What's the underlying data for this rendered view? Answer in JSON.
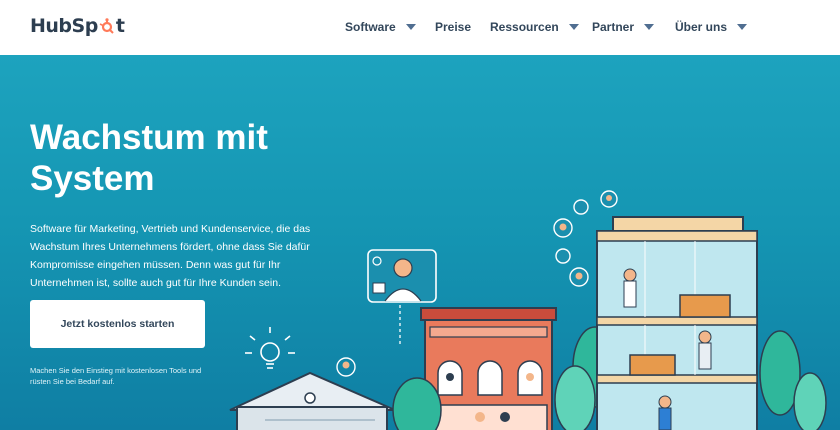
{
  "brand": {
    "logo_text_left": "HubSp",
    "logo_text_right": "t"
  },
  "nav": {
    "items": [
      {
        "label": "Software",
        "has_dropdown": true
      },
      {
        "label": "Preise",
        "has_dropdown": false
      },
      {
        "label": "Ressourcen",
        "has_dropdown": true
      },
      {
        "label": "Partner",
        "has_dropdown": true
      },
      {
        "label": "Über uns",
        "has_dropdown": true
      }
    ]
  },
  "hero": {
    "headline_line1": "Wachstum mit",
    "headline_line2": "System",
    "description": "Software für Marketing, Vertrieb und Kundenservice, die das Wachstum Ihres Unternehmens fördert, ohne dass Sie dafür Kompromisse eingehen müssen. Denn was gut für Ihr Unternehmen ist, sollte auch gut für Ihre Kunden sein.",
    "cta_label": "Jetzt kostenlos starten",
    "smallprint": "Machen Sie den Einstieg mit kostenlosen Tools und rüsten Sie bei Bedarf auf."
  },
  "colors": {
    "accent": "#ff7a59",
    "text_dark": "#33475b",
    "hero_bg": "#1596b3",
    "white": "#ffffff"
  }
}
